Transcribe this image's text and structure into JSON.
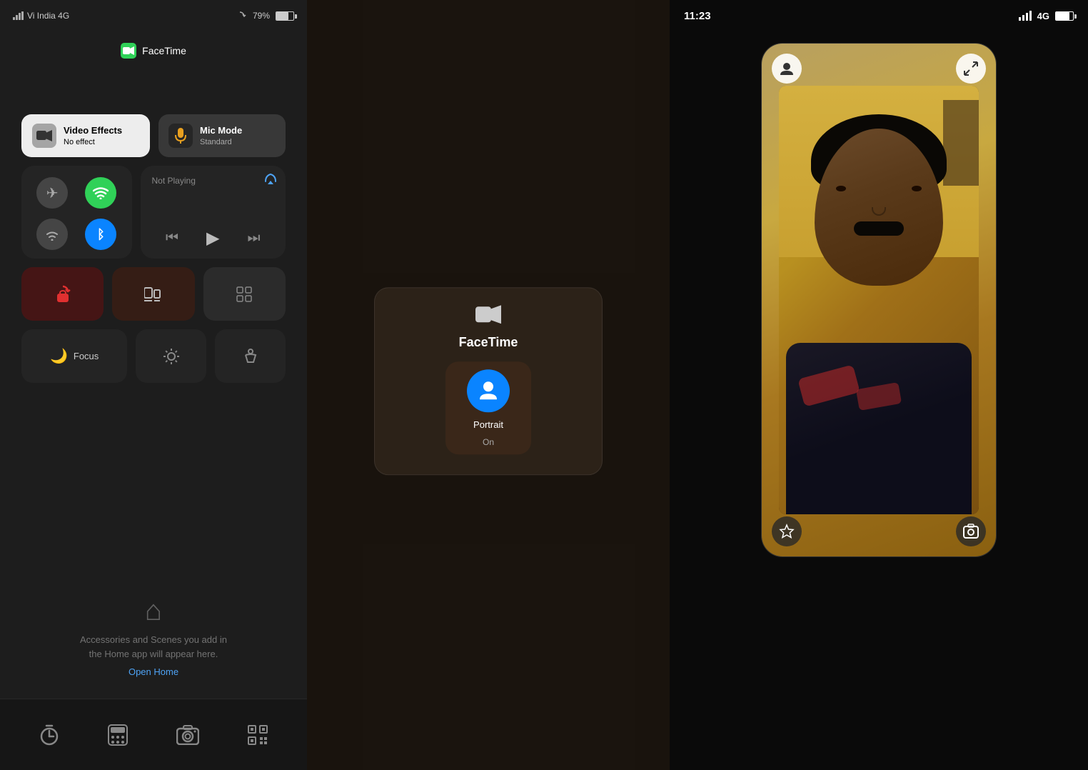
{
  "panel_left": {
    "status_bar": {
      "carrier": "Vi India 4G",
      "battery": "79%"
    },
    "facetime_header": {
      "label": "FaceTime"
    },
    "video_effects": {
      "title": "Video Effects",
      "subtitle": "No effect"
    },
    "mic_mode": {
      "title": "Mic Mode",
      "subtitle": "Standard"
    },
    "now_playing": {
      "label": "Not Playing"
    },
    "focus": {
      "label": "Focus"
    },
    "home_section": {
      "text": "Accessories and Scenes you add in\nthe Home app will appear here.",
      "link": "Open Home"
    }
  },
  "panel_middle": {
    "popup": {
      "title": "FaceTime",
      "portrait_label": "Portrait",
      "portrait_state": "On"
    }
  },
  "panel_right": {
    "status_bar": {
      "time": "11:23",
      "signal": "4G"
    }
  }
}
